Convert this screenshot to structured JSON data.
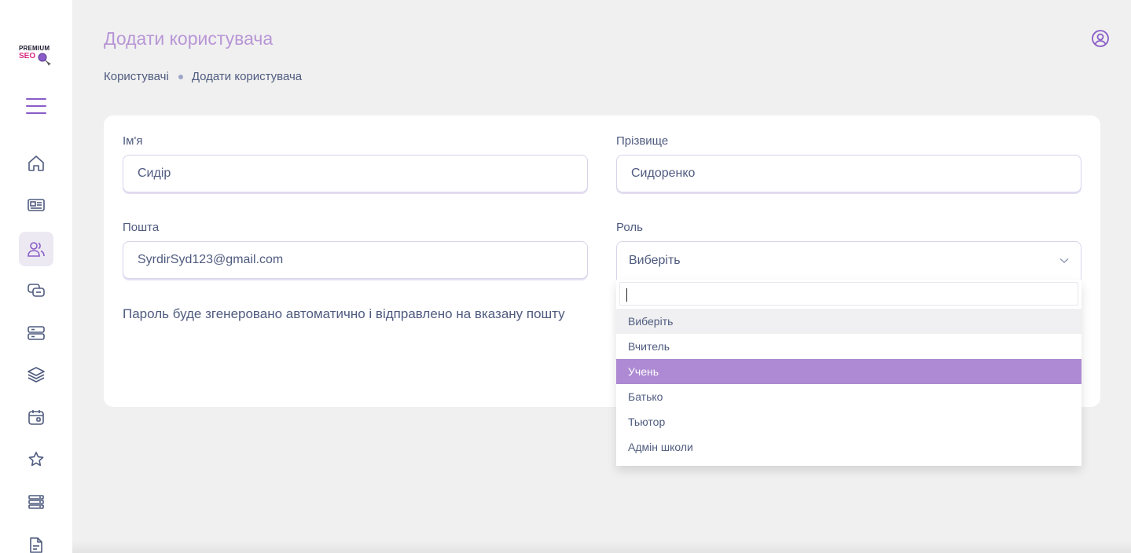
{
  "logo": {
    "line1": "PREMIUM",
    "line2": "SEO"
  },
  "header": {
    "title": "Додати користувача"
  },
  "breadcrumb": {
    "item1": "Користувачі",
    "item2": "Додати користувача"
  },
  "form": {
    "first_name_label": "Ім'я",
    "first_name_value": "Сидір",
    "last_name_label": "Прізвище",
    "last_name_value": "Сидоренко",
    "email_label": "Пошта",
    "email_value": "SyrdirSyd123@gmail.com",
    "role_label": "Роль",
    "role_selected": "Виберіть",
    "password_note": "Пароль буде згенеровано автоматично і відправлено на вказану пошту"
  },
  "dropdown": {
    "search_value": "",
    "options": [
      "Виберіть",
      "Вчитель",
      "Учень",
      "Батько",
      "Тьютор",
      "Адмін школи"
    ],
    "current_index": 0,
    "highlighted_index": 2
  },
  "colors": {
    "accent": "#b896d6",
    "highlight": "#ad8ad3",
    "text": "#4f5b7f",
    "icon": "#8a5cc8",
    "background": "#f0f0f0"
  },
  "sidebar_icons": [
    "home-icon",
    "newspaper-icon",
    "users-icon",
    "chat-icon",
    "server-icon",
    "layers-icon",
    "calendar-icon",
    "star-icon",
    "list-icon",
    "document-icon"
  ],
  "sidebar_active": "users-icon"
}
